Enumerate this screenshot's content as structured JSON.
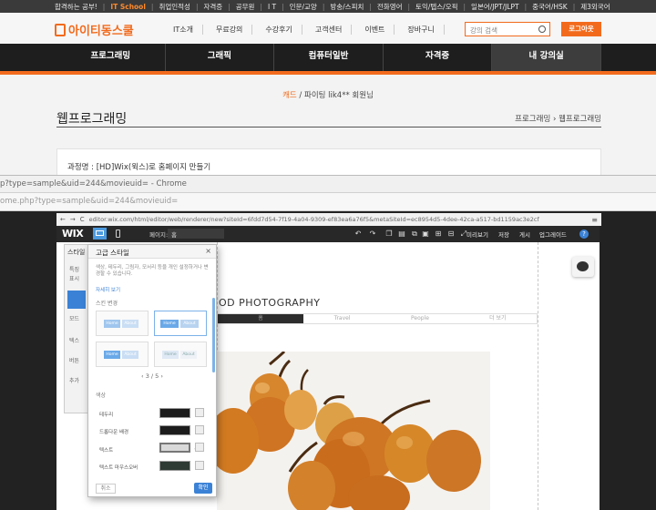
{
  "top_strip": {
    "items": [
      "합격하는 공부!",
      "IT School",
      "취업인적성",
      "자격증",
      "공무원",
      "I T",
      "인문/교양",
      "방송/스피치",
      "전화영어",
      "토익/텝스/오픽",
      "일본어/JPT/JLPT",
      "중국어/HSK",
      "제3외국어"
    ]
  },
  "site_header": {
    "logo": "아이티동스쿨",
    "nav": [
      "IT소개",
      "무료강의",
      "수강후기",
      "고객센터",
      "이벤트",
      "장바구니"
    ],
    "search_placeholder": "강의 검색",
    "logout": "로그아웃"
  },
  "main_nav": {
    "items": [
      "프로그래밍",
      "그래픽",
      "컴퓨터일반",
      "자격증",
      "내 강의실"
    ]
  },
  "page": {
    "welcome_prefix": "캐드",
    "welcome_rest": " / 파이팅 lik4** 회원님",
    "title": "웹프로그래밍",
    "breadcrumb": "프로그래밍 › 웹프로그래밍",
    "course": "과정명 : [HD]Wix(윅스)로 홈페이지 만들기"
  },
  "popup": {
    "bar1": "p?type=sample&uid=244&movieuid= - Chrome",
    "bar2": "ome.php?type=sample&uid=244&movieuid="
  },
  "browser": {
    "back": "←",
    "forward": "→",
    "reload": "C",
    "url": "editor.wix.com/html/editor/web/renderer/new?siteId=6fdd7d54-7f19-4a04-9309-ef83ea6a76f5&metaSiteId=ec8954d5-4dee-42ca-a517-bd1159ac3e2cf",
    "menu": "≡"
  },
  "wix_toolbar": {
    "logo": "WIX",
    "page_label": "페이지:",
    "page_value": "홈",
    "preview": "미리보기",
    "save": "저장",
    "publish": "게시",
    "upgrade": "업그레이드",
    "help": "?"
  },
  "site": {
    "title": "OD PHOTOGRAPHY",
    "menu": [
      "홈",
      "Travel",
      "People",
      "더 보기"
    ]
  },
  "left_panel": {
    "title": "스타일",
    "lines": [
      "특징",
      "표시",
      "모드",
      "텍스",
      "버튼",
      "추가"
    ]
  },
  "dialog": {
    "title": "고급 스타일",
    "close": "×",
    "desc": "색상, 테두리, 그림자, 모서리 등을 개인 설정하거나 변경할 수 있습니다.",
    "link": "자세히 보기",
    "skin_label": "스킨 변경",
    "skin_btn": [
      "Home",
      "About"
    ],
    "pager": "‹  3 / 5  ›",
    "section": "색상",
    "rows": [
      "테두리",
      "드롭다운 배경",
      "텍스트",
      "텍스트 마우스오버"
    ],
    "cancel": "취소",
    "ok": "확인"
  },
  "colors": {
    "brand_orange": "#f26b1d",
    "wix_blue": "#3b82d6",
    "swatch_dark": "#1c1c1c",
    "swatch_light": "#d9d9d9",
    "swatch_green": "#2e3a34"
  }
}
